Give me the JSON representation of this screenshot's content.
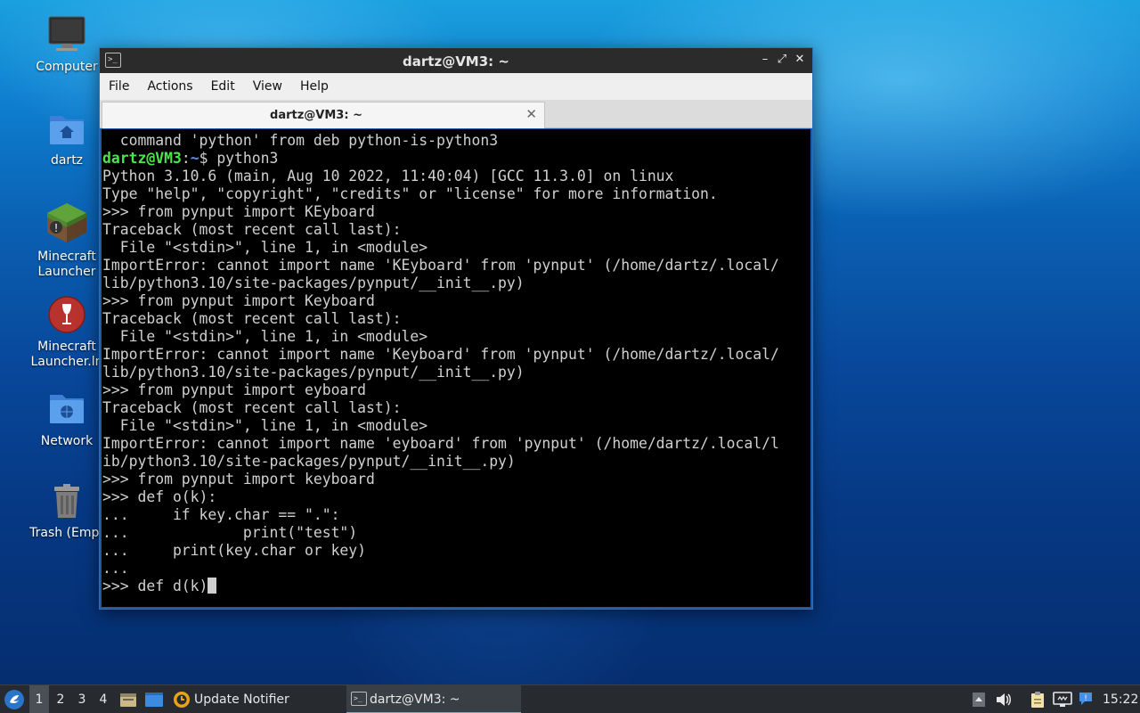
{
  "desktop": {
    "icons": [
      {
        "label": "Computer",
        "icon": "computer-icon"
      },
      {
        "label": "dartz",
        "icon": "home-folder-icon"
      },
      {
        "label": "Minecraft\nLauncher",
        "icon": "minecraft-grass-block-icon"
      },
      {
        "label": "Minecraft\nLauncher.ln",
        "icon": "wine-glass-icon"
      },
      {
        "label": "Network",
        "icon": "network-folder-icon"
      },
      {
        "label": "Trash (Empt",
        "icon": "trash-icon"
      }
    ]
  },
  "window": {
    "title": "dartz@VM3: ~",
    "menu": [
      "File",
      "Actions",
      "Edit",
      "View",
      "Help"
    ],
    "tab_title": "dartz@VM3: ~",
    "controls": {
      "minimize": "–",
      "maximize": "⤢",
      "close": "✕"
    }
  },
  "terminal": {
    "prompt_user": "dartz@VM3",
    "prompt_sep": ":",
    "prompt_path": "~",
    "prompt_dollar": "$ ",
    "prompt_command": "python3",
    "first_line": "  command 'python' from deb python-is-python3",
    "lines": [
      "Python 3.10.6 (main, Aug 10 2022, 11:40:04) [GCC 11.3.0] on linux",
      "Type \"help\", \"copyright\", \"credits\" or \"license\" for more information.",
      ">>> from pynput import KEyboard",
      "Traceback (most recent call last):",
      "  File \"<stdin>\", line 1, in <module>",
      "ImportError: cannot import name 'KEyboard' from 'pynput' (/home/dartz/.local/",
      "lib/python3.10/site-packages/pynput/__init__.py)",
      ">>> from pynput import Keyboard",
      "Traceback (most recent call last):",
      "  File \"<stdin>\", line 1, in <module>",
      "ImportError: cannot import name 'Keyboard' from 'pynput' (/home/dartz/.local/",
      "lib/python3.10/site-packages/pynput/__init__.py)",
      ">>> from pynput import eyboard",
      "Traceback (most recent call last):",
      "  File \"<stdin>\", line 1, in <module>",
      "ImportError: cannot import name 'eyboard' from 'pynput' (/home/dartz/.local/l",
      "ib/python3.10/site-packages/pynput/__init__.py)",
      ">>> from pynput import keyboard",
      ">>> def o(k):",
      "...     if key.char == \".\":",
      "...             print(\"test\")",
      "...     print(key.char or key)",
      "..."
    ],
    "current_input": ">>> def d(k)"
  },
  "taskbar": {
    "workspaces": [
      "1",
      "2",
      "3",
      "4"
    ],
    "active_workspace": "1",
    "tasks": [
      {
        "label": "Update Notifier",
        "icon": "update-notifier-icon"
      },
      {
        "label": "dartz@VM3: ~",
        "icon": "terminal-icon"
      }
    ],
    "clock": "15:22"
  }
}
